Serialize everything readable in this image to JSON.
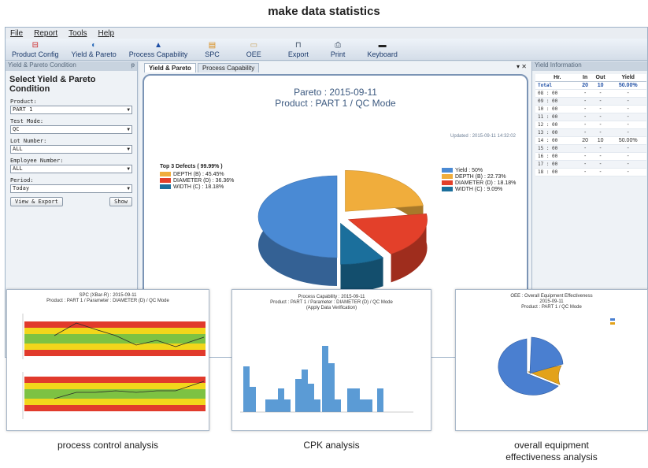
{
  "headline": "make data statistics",
  "menu": [
    "File",
    "Report",
    "Tools",
    "Help"
  ],
  "toolbar": [
    {
      "label": "Product Config",
      "icon": "product-config-icon"
    },
    {
      "label": "Yield & Pareto",
      "icon": "yield-pareto-icon"
    },
    {
      "label": "Process Capability",
      "icon": "process-capability-icon"
    },
    {
      "label": "SPC",
      "icon": "spc-icon"
    },
    {
      "label": "OEE",
      "icon": "oee-icon"
    },
    {
      "label": "Export",
      "icon": "export-icon"
    },
    {
      "label": "Print",
      "icon": "print-icon"
    },
    {
      "label": "Keyboard",
      "icon": "keyboard-icon"
    }
  ],
  "left": {
    "panel_title": "Yield & Pareto Condition",
    "pin": "ᵽ",
    "heading": "Select Yield & Pareto Condition",
    "fields": [
      {
        "label": "Product:",
        "value": "PART 1"
      },
      {
        "label": "Test Mode:",
        "value": "QC"
      },
      {
        "label": "Lot Number:",
        "value": "ALL"
      },
      {
        "label": "Employee Number:",
        "value": "ALL"
      },
      {
        "label": "Period:",
        "value": "Today"
      }
    ],
    "view_export": "View & Export",
    "show": "Show"
  },
  "center": {
    "tabs": [
      "Yield & Pareto",
      "Process Capability"
    ],
    "tab_controls": "▾ ✕",
    "title1": "Pareto : 2015-09-11",
    "title2": "Product : PART 1 / QC Mode",
    "updated": "Updated : 2015-09-11 14:32:02",
    "top3_title": "Top 3 Defects ( 99.99% )",
    "top3": [
      {
        "label": "DEPTH (B) : 45.45%",
        "color": "#f0ad3c"
      },
      {
        "label": "DIAMETER (D) : 36.36%",
        "color": "#e3402a"
      },
      {
        "label": "WIDTH (C) : 18.18%",
        "color": "#1b6f9c"
      }
    ],
    "legend": [
      {
        "label": "Yield : 50%",
        "color": "#4a8ad4"
      },
      {
        "label": "DEPTH (B) : 22.73%",
        "color": "#f0ad3c"
      },
      {
        "label": "DIAMETER (D) : 18.18%",
        "color": "#e3402a"
      },
      {
        "label": "WIDTH (C) : 9.09%",
        "color": "#1b6f9c"
      }
    ]
  },
  "right": {
    "panel_title": "Yield Information",
    "headers": [
      "Hr.",
      "In",
      "Out",
      "Yield"
    ],
    "rows": [
      [
        "Total",
        "20",
        "10",
        "50.00%"
      ],
      [
        "08 : 00",
        "-",
        "-",
        "-"
      ],
      [
        "09 : 00",
        "-",
        "-",
        "-"
      ],
      [
        "10 : 00",
        "-",
        "-",
        "-"
      ],
      [
        "11 : 00",
        "-",
        "-",
        "-"
      ],
      [
        "12 : 00",
        "-",
        "-",
        "-"
      ],
      [
        "13 : 00",
        "-",
        "-",
        "-"
      ],
      [
        "14 : 00",
        "20",
        "10",
        "50.00%"
      ],
      [
        "15 : 00",
        "-",
        "-",
        "-"
      ],
      [
        "16 : 00",
        "-",
        "-",
        "-"
      ],
      [
        "17 : 00",
        "-",
        "-",
        "-"
      ],
      [
        "18 : 00",
        "-",
        "-",
        "-"
      ]
    ]
  },
  "spc": {
    "title1": "SPC (XBar-R) : 2015-09-11",
    "title2": "Product : PART 1 / Parameter : DIAMETER (D) / QC Mode",
    "caption": "process control analysis"
  },
  "cpk": {
    "title1": "Process Capability : 2015-09-11",
    "title2": "Product : PART 1 / Parameter : DIAMETER (D) / QC Mode",
    "title3": "(Apply Data Verification)",
    "caption": "CPK analysis"
  },
  "oee": {
    "title1": "OEE : Overall Equipment Effectiveness",
    "title2": "2015-09-11",
    "title3": "Product : PART 1 / QC Mode",
    "caption1": "overall equipment",
    "caption2": "effectiveness analysis"
  },
  "chart_data": {
    "type": "pie",
    "categories": [
      "Yield",
      "DEPTH (B)",
      "DIAMETER (D)",
      "WIDTH (C)"
    ],
    "values": [
      50,
      22.73,
      18.18,
      9.09
    ],
    "colors": [
      "#4a8ad4",
      "#f0ad3c",
      "#e3402a",
      "#1b6f9c"
    ]
  },
  "colors": {
    "accent": "#3d5a80",
    "frame": "#7b94b5"
  }
}
